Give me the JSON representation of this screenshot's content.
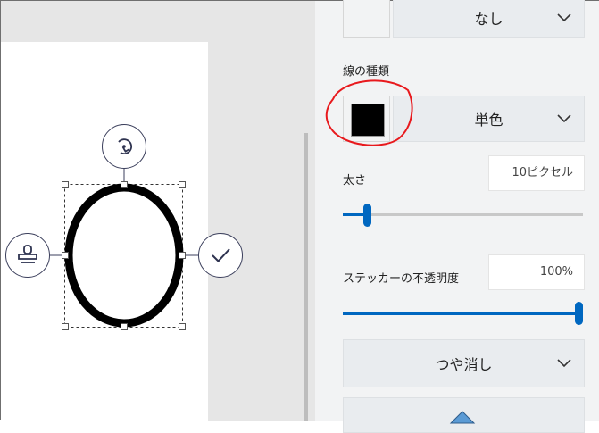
{
  "fill": {
    "value": "なし"
  },
  "line_type": {
    "label": "線の種類",
    "color_hex": "#000000",
    "annotation_color": "#e8191d",
    "value": "単色"
  },
  "thickness": {
    "label": "太さ",
    "value": "10ピクセル",
    "slider_fraction": 0.1
  },
  "opacity": {
    "label": "ステッカーの不透明度",
    "value": "100%",
    "slider_fraction": 1.0
  },
  "finish": {
    "value": "つや消し"
  },
  "colors": {
    "accent": "#0067c0",
    "track": "#c8c8c8",
    "shape": "#000000"
  },
  "icons": {
    "rotate": "rotate-icon",
    "stamp": "stamp-icon",
    "confirm": "checkmark-icon",
    "chevron": "chevron-down-icon"
  }
}
